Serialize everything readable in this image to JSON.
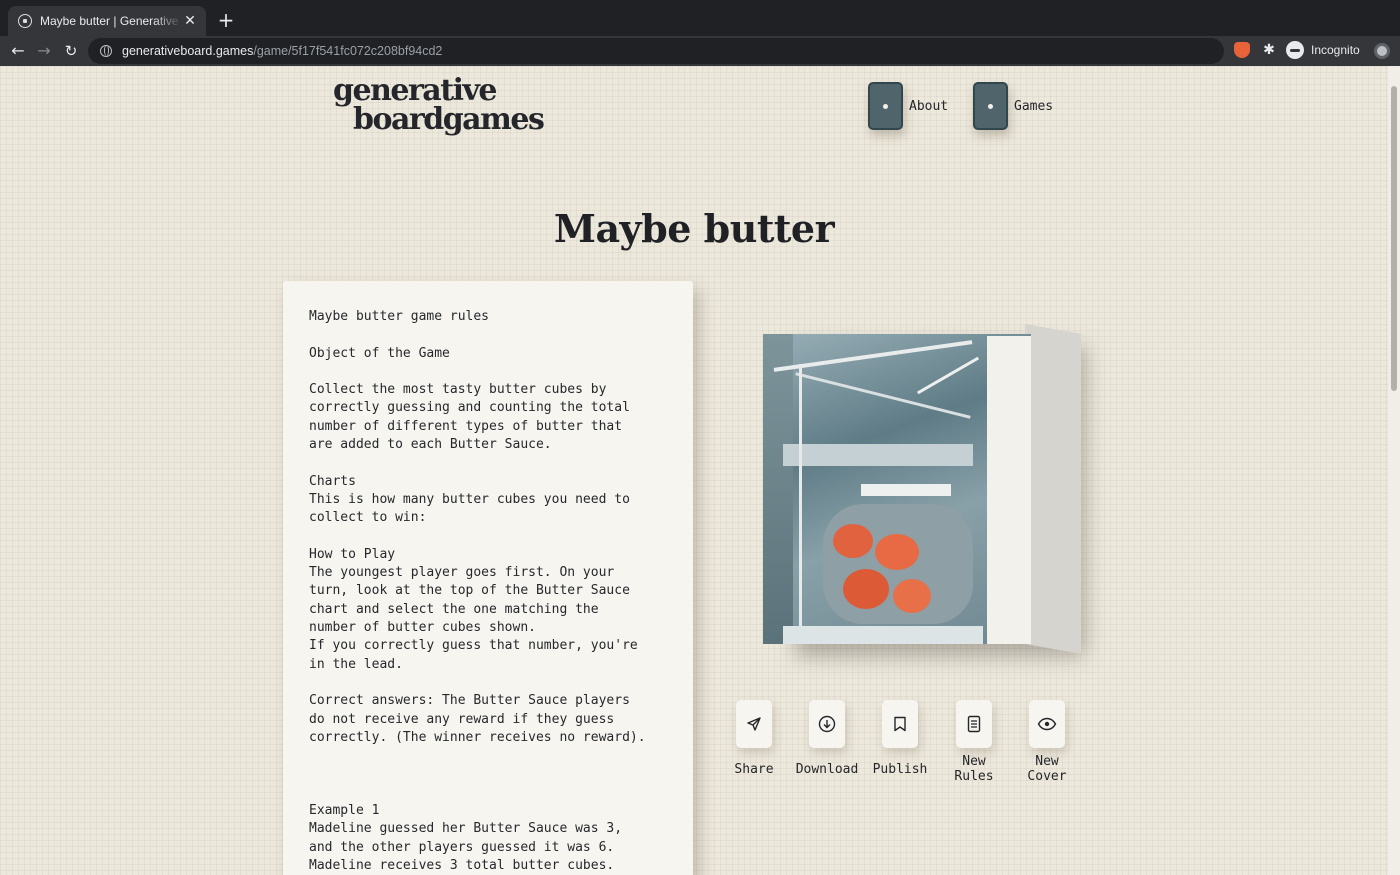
{
  "browser": {
    "tab_title": "Maybe butter | Generative Board Games",
    "tab_close": "✕",
    "new_tab": "+",
    "url_host": "generativeboard.games",
    "url_path": "/game/5f17f541fc072c208bf94cd2",
    "incognito_label": "Incognito",
    "back": "←",
    "forward": "→",
    "reload": "↻",
    "extensions_glyph": "✱"
  },
  "header": {
    "logo_line1": "generative",
    "logo_line2": "boardgames",
    "nav": [
      {
        "label": "About",
        "icon": "card-icon"
      },
      {
        "label": "Games",
        "icon": "card-icon"
      }
    ]
  },
  "game": {
    "title": "Maybe butter",
    "rules": "Maybe butter game rules\n\nObject of the Game\n\nCollect the most tasty butter cubes by\ncorrectly guessing and counting the total\nnumber of different types of butter that\nare added to each Butter Sauce.\n\nCharts\nThis is how many butter cubes you need to\ncollect to win:\n\nHow to Play\nThe youngest player goes first. On your\nturn, look at the top of the Butter Sauce\nchart and select the one matching the\nnumber of butter cubes shown.\nIf you correctly guess that number, you're\nin the lead.\n\nCorrect answers: The Butter Sauce players\ndo not receive any reward if they guess\ncorrectly. (The winner receives no reward).\n\n\n\nExample 1\nMadeline guessed her Butter Sauce was 3,\nand the other players guessed it was 6.\nMadeline receives 3 total butter cubes."
  },
  "actions": [
    {
      "label": "Share",
      "icon": "paper-plane-icon"
    },
    {
      "label": "Download",
      "icon": "download-circle-icon"
    },
    {
      "label": "Publish",
      "icon": "bookmark-icon"
    },
    {
      "label": "New\nRules",
      "icon": "document-icon"
    },
    {
      "label": "New\nCover",
      "icon": "eye-icon"
    }
  ],
  "colors": {
    "page_bg": "#ede8dc",
    "card_bg": "#4f656b",
    "text": "#24262b"
  }
}
